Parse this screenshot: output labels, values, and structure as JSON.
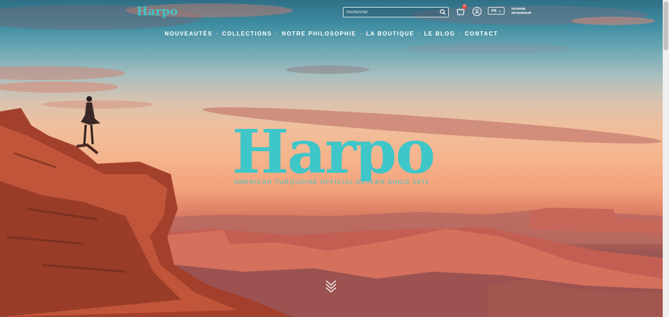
{
  "brand": {
    "logo_text": "Harpo",
    "accent_color": "#3ec6c9"
  },
  "header": {
    "search": {
      "placeholder": "Rechercher",
      "icon": "search-icon"
    },
    "cart": {
      "icon": "basket-icon",
      "count": "0"
    },
    "account": {
      "icon": "user-icon"
    },
    "language": {
      "selected": "FR"
    },
    "reseller": {
      "line1": "DEVENIR",
      "line2": "REVENDEUR"
    }
  },
  "nav": {
    "items": [
      {
        "label": "NOUVEAUTÉS"
      },
      {
        "label": "COLLECTIONS"
      },
      {
        "label": "NOTRE PHILOSOPHIE"
      },
      {
        "label": "LA BOUTIQUE"
      },
      {
        "label": "LE BLOG"
      },
      {
        "label": "CONTACT"
      }
    ]
  },
  "hero": {
    "title": "Harpo",
    "tagline": "AMERICAN TURQUOISE OFFICIAL DEALER SINCE 1971",
    "scroll_icon": "chevrons-down-icon"
  }
}
